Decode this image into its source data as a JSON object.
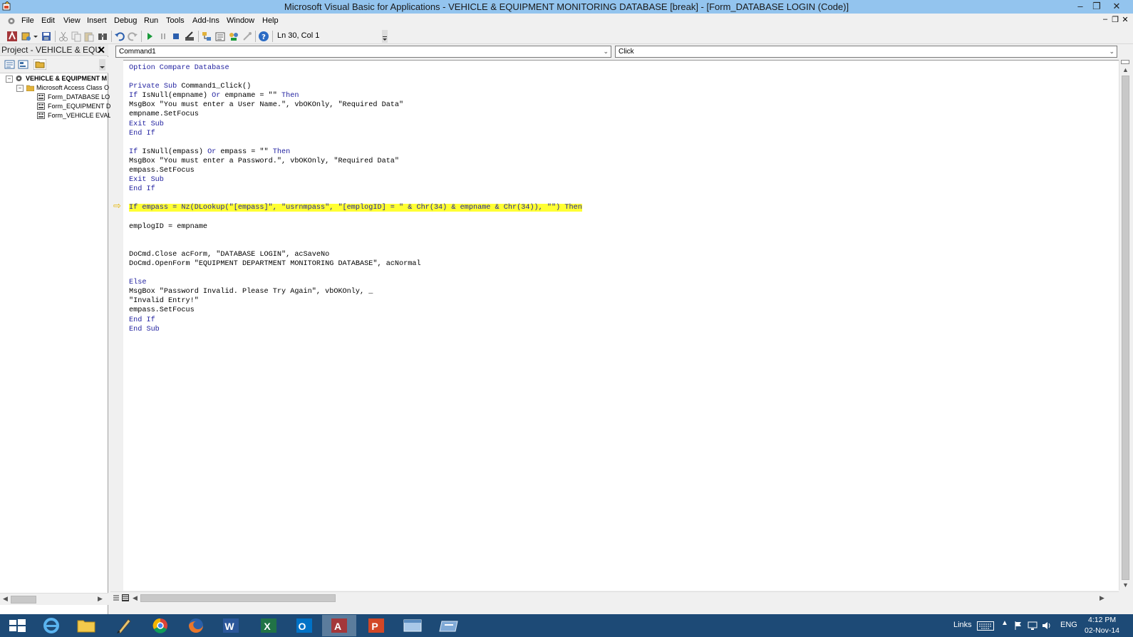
{
  "window": {
    "title": "Microsoft Visual Basic for Applications - VEHICLE & EQUIPMENT MONITORING DATABASE [break] - [Form_DATABASE LOGIN (Code)]",
    "controls": {
      "minimize": "–",
      "restore": "❐",
      "close": "✕"
    }
  },
  "menu": {
    "items": [
      "File",
      "Edit",
      "View",
      "Insert",
      "Debug",
      "Run",
      "Tools",
      "Add-Ins",
      "Window",
      "Help"
    ],
    "mdi_controls": {
      "minimize": "–",
      "restore": "❐",
      "close": "✕"
    }
  },
  "toolbar": {
    "position_readout": "Ln 30, Col 1",
    "icons": [
      "view-access-icon",
      "insert-module-icon",
      "save-icon",
      "cut-icon",
      "copy-icon",
      "paste-icon",
      "find-icon",
      "undo-icon",
      "redo-icon",
      "run-icon",
      "break-icon",
      "reset-icon",
      "design-mode-icon",
      "project-explorer-icon",
      "properties-icon",
      "object-browser-icon",
      "toolbox-icon",
      "help-icon"
    ]
  },
  "project": {
    "title": "Project - VEHICLE & EQU",
    "close": "✕",
    "root": "VEHICLE & EQUIPMENT M",
    "folder": "Microsoft Access Class O",
    "items": [
      "Form_DATABASE LO",
      "Form_EQUIPMENT D",
      "Form_VEHICLE EVAL"
    ],
    "expander_minus": "−"
  },
  "code": {
    "object_combo": "Command1",
    "procedure_combo": "Click",
    "combo_arrow": "⌄",
    "execution_arrow": "⇨"
  },
  "taskbar": {
    "apps": [
      "start-icon",
      "internet-explorer-icon",
      "file-explorer-icon",
      "pen-tool-icon",
      "chrome-icon",
      "firefox-icon",
      "word-icon",
      "excel-icon",
      "outlook-icon",
      "access-icon",
      "powerpoint-icon",
      "window-app-icon",
      "remote-app-icon"
    ],
    "links": "Links",
    "language": "ENG",
    "time": "4:12 PM",
    "date": "02-Nov-14"
  },
  "colors": {
    "title_bar": "#93c4ee",
    "taskbar": "#1d4a76",
    "keyword": "#1f1f9f",
    "highlight": "#ffff33"
  }
}
